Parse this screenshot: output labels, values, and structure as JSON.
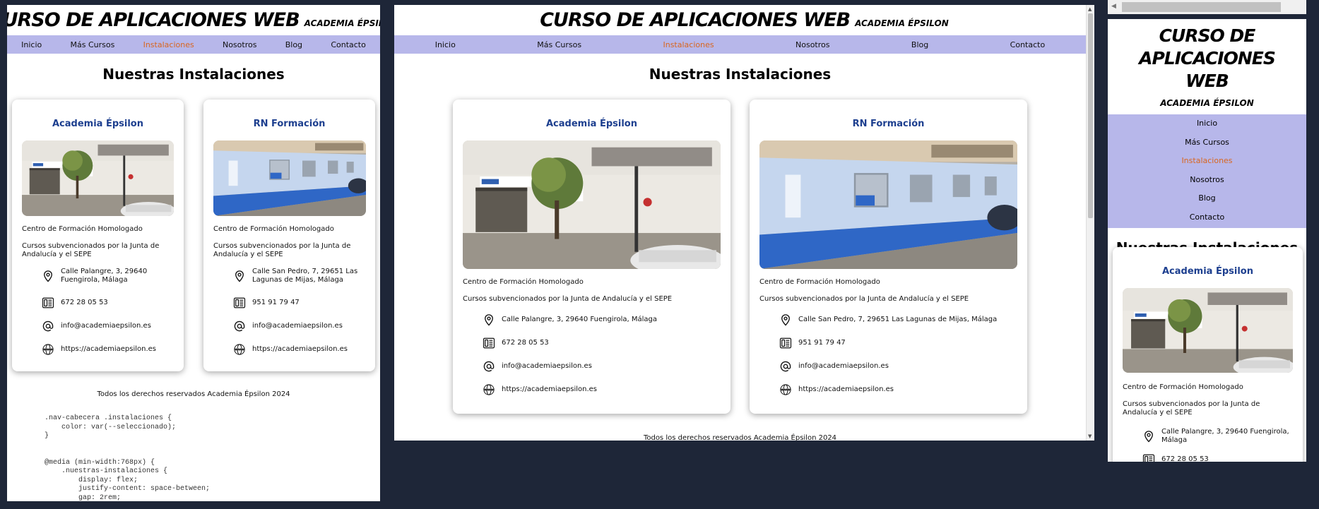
{
  "site": {
    "title": "CURSO DE APLICACIONES WEB",
    "subtitle": "ACADEMIA ÉPSILON"
  },
  "nav": {
    "items": [
      "Inicio",
      "Más Cursos",
      "Instalaciones",
      "Nosotros",
      "Blog",
      "Contacto"
    ],
    "active": 2
  },
  "section": {
    "title": "Nuestras Instalaciones"
  },
  "cards": [
    {
      "title": "Academia Épsilon",
      "desc1": "Centro de Formación Homologado",
      "desc2": "Cursos subvencionados por la Junta de Andalucía y el SEPE",
      "address": "Calle Palangre, 3, 29640 Fuengirola, Málaga",
      "phone": "672 28 05 53",
      "email": "info@academiaepsilon.es",
      "web": "https://academiaepsilon.es"
    },
    {
      "title": "RN Formación",
      "desc1": "Centro de Formación Homologado",
      "desc2": "Cursos subvencionados por la Junta de Andalucía y el SEPE",
      "address": "Calle San Pedro, 7, 29651 Las Lagunas de Mijas, Málaga",
      "phone": "951 91 79 47",
      "email": "info@academiaepsilon.es",
      "web": "https://academiaepsilon.es"
    }
  ],
  "footer": {
    "text": "Todos los derechos reservados Academia Épsilon 2024"
  },
  "code": {
    "lines": [
      ".nav-cabecera .instalaciones {",
      "    color: var(--seleccionado);",
      "}",
      "",
      "",
      "@media (min-width:768px) {",
      "    .nuestras-instalaciones {",
      "        display: flex;",
      "        justify-content: space-between;",
      "        gap: 2rem;"
    ]
  },
  "colors": {
    "nav_bg": "#b7b7ea",
    "active": "#d9661f",
    "card_title": "#1d3f8f",
    "background": "#1e2638"
  }
}
